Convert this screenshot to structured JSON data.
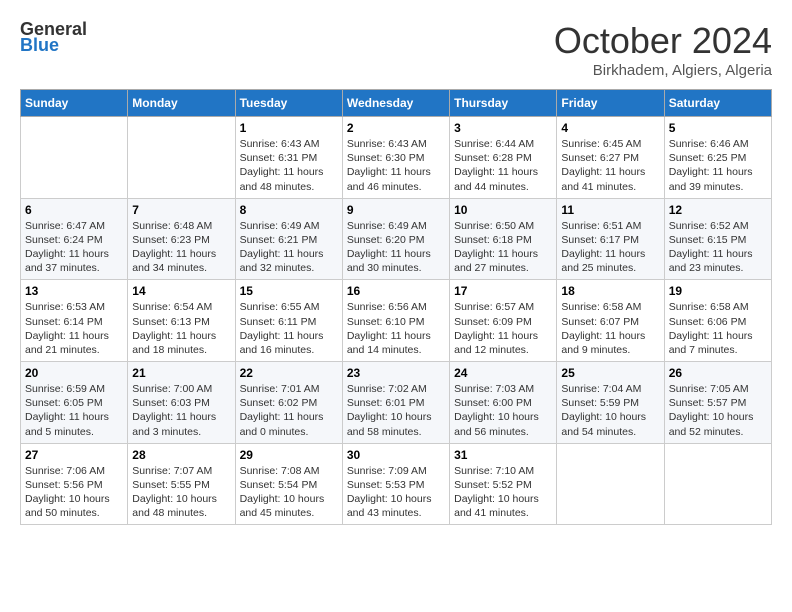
{
  "header": {
    "logo_general": "General",
    "logo_blue": "Blue",
    "month_title": "October 2024",
    "location": "Birkhadem, Algiers, Algeria"
  },
  "calendar": {
    "days_of_week": [
      "Sunday",
      "Monday",
      "Tuesday",
      "Wednesday",
      "Thursday",
      "Friday",
      "Saturday"
    ],
    "weeks": [
      [
        {
          "day": "",
          "info": ""
        },
        {
          "day": "",
          "info": ""
        },
        {
          "day": "1",
          "info": "Sunrise: 6:43 AM\nSunset: 6:31 PM\nDaylight: 11 hours and 48 minutes."
        },
        {
          "day": "2",
          "info": "Sunrise: 6:43 AM\nSunset: 6:30 PM\nDaylight: 11 hours and 46 minutes."
        },
        {
          "day": "3",
          "info": "Sunrise: 6:44 AM\nSunset: 6:28 PM\nDaylight: 11 hours and 44 minutes."
        },
        {
          "day": "4",
          "info": "Sunrise: 6:45 AM\nSunset: 6:27 PM\nDaylight: 11 hours and 41 minutes."
        },
        {
          "day": "5",
          "info": "Sunrise: 6:46 AM\nSunset: 6:25 PM\nDaylight: 11 hours and 39 minutes."
        }
      ],
      [
        {
          "day": "6",
          "info": "Sunrise: 6:47 AM\nSunset: 6:24 PM\nDaylight: 11 hours and 37 minutes."
        },
        {
          "day": "7",
          "info": "Sunrise: 6:48 AM\nSunset: 6:23 PM\nDaylight: 11 hours and 34 minutes."
        },
        {
          "day": "8",
          "info": "Sunrise: 6:49 AM\nSunset: 6:21 PM\nDaylight: 11 hours and 32 minutes."
        },
        {
          "day": "9",
          "info": "Sunrise: 6:49 AM\nSunset: 6:20 PM\nDaylight: 11 hours and 30 minutes."
        },
        {
          "day": "10",
          "info": "Sunrise: 6:50 AM\nSunset: 6:18 PM\nDaylight: 11 hours and 27 minutes."
        },
        {
          "day": "11",
          "info": "Sunrise: 6:51 AM\nSunset: 6:17 PM\nDaylight: 11 hours and 25 minutes."
        },
        {
          "day": "12",
          "info": "Sunrise: 6:52 AM\nSunset: 6:15 PM\nDaylight: 11 hours and 23 minutes."
        }
      ],
      [
        {
          "day": "13",
          "info": "Sunrise: 6:53 AM\nSunset: 6:14 PM\nDaylight: 11 hours and 21 minutes."
        },
        {
          "day": "14",
          "info": "Sunrise: 6:54 AM\nSunset: 6:13 PM\nDaylight: 11 hours and 18 minutes."
        },
        {
          "day": "15",
          "info": "Sunrise: 6:55 AM\nSunset: 6:11 PM\nDaylight: 11 hours and 16 minutes."
        },
        {
          "day": "16",
          "info": "Sunrise: 6:56 AM\nSunset: 6:10 PM\nDaylight: 11 hours and 14 minutes."
        },
        {
          "day": "17",
          "info": "Sunrise: 6:57 AM\nSunset: 6:09 PM\nDaylight: 11 hours and 12 minutes."
        },
        {
          "day": "18",
          "info": "Sunrise: 6:58 AM\nSunset: 6:07 PM\nDaylight: 11 hours and 9 minutes."
        },
        {
          "day": "19",
          "info": "Sunrise: 6:58 AM\nSunset: 6:06 PM\nDaylight: 11 hours and 7 minutes."
        }
      ],
      [
        {
          "day": "20",
          "info": "Sunrise: 6:59 AM\nSunset: 6:05 PM\nDaylight: 11 hours and 5 minutes."
        },
        {
          "day": "21",
          "info": "Sunrise: 7:00 AM\nSunset: 6:03 PM\nDaylight: 11 hours and 3 minutes."
        },
        {
          "day": "22",
          "info": "Sunrise: 7:01 AM\nSunset: 6:02 PM\nDaylight: 11 hours and 0 minutes."
        },
        {
          "day": "23",
          "info": "Sunrise: 7:02 AM\nSunset: 6:01 PM\nDaylight: 10 hours and 58 minutes."
        },
        {
          "day": "24",
          "info": "Sunrise: 7:03 AM\nSunset: 6:00 PM\nDaylight: 10 hours and 56 minutes."
        },
        {
          "day": "25",
          "info": "Sunrise: 7:04 AM\nSunset: 5:59 PM\nDaylight: 10 hours and 54 minutes."
        },
        {
          "day": "26",
          "info": "Sunrise: 7:05 AM\nSunset: 5:57 PM\nDaylight: 10 hours and 52 minutes."
        }
      ],
      [
        {
          "day": "27",
          "info": "Sunrise: 7:06 AM\nSunset: 5:56 PM\nDaylight: 10 hours and 50 minutes."
        },
        {
          "day": "28",
          "info": "Sunrise: 7:07 AM\nSunset: 5:55 PM\nDaylight: 10 hours and 48 minutes."
        },
        {
          "day": "29",
          "info": "Sunrise: 7:08 AM\nSunset: 5:54 PM\nDaylight: 10 hours and 45 minutes."
        },
        {
          "day": "30",
          "info": "Sunrise: 7:09 AM\nSunset: 5:53 PM\nDaylight: 10 hours and 43 minutes."
        },
        {
          "day": "31",
          "info": "Sunrise: 7:10 AM\nSunset: 5:52 PM\nDaylight: 10 hours and 41 minutes."
        },
        {
          "day": "",
          "info": ""
        },
        {
          "day": "",
          "info": ""
        }
      ]
    ]
  }
}
